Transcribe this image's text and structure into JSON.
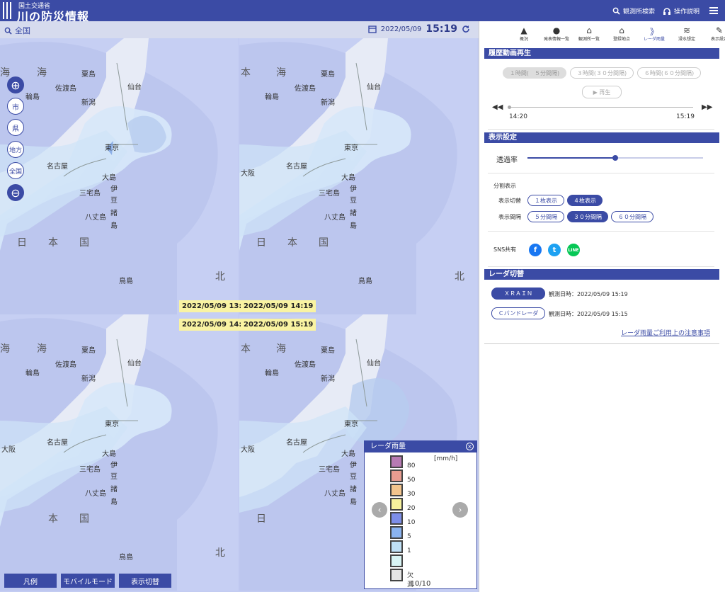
{
  "header": {
    "ministry": "国土交通省",
    "title": "川の防災情報",
    "station_search": "観測所検索",
    "help": "操作説明"
  },
  "map": {
    "area": "全国",
    "date": "2022/05/09",
    "time": "15:19",
    "panels": [
      {
        "timestamp": "2022/05/09 13:49"
      },
      {
        "timestamp": "2022/05/09 14:19"
      },
      {
        "timestamp": "2022/05/09 14:49"
      },
      {
        "timestamp": "2022/05/09 15:19"
      }
    ],
    "place_labels": {
      "sea1": "海",
      "sea2": "本",
      "sea3": "日",
      "sea4": "本",
      "sea5": "国",
      "sendai": "仙台",
      "niigata": "新潟",
      "sado": "佐渡島",
      "awa": "粟島",
      "wajima": "輪島",
      "tokyo": "東京",
      "nagoya": "名古屋",
      "osaka": "大阪",
      "oshima": "大島",
      "miyake": "三宅島",
      "izu1": "伊",
      "izu2": "豆",
      "izu3": "諸",
      "izu4": "島",
      "hachijo": "八丈島",
      "tori": "鳥島",
      "north": "北",
      "okushiri": "奥尻"
    },
    "zoom_controls": {
      "city": "市",
      "prefecture": "県",
      "region": "地方",
      "nationwide": "全国"
    },
    "buttons": {
      "legend": "凡例",
      "mobile": "モバイルモード",
      "display_switch": "表示切替"
    }
  },
  "legend": {
    "title": "レーダ雨量",
    "unit": "[mm/h]",
    "items": [
      {
        "label": "80",
        "color": "#b77ab3"
      },
      {
        "label": "50",
        "color": "#e89c90"
      },
      {
        "label": "30",
        "color": "#f2c48d"
      },
      {
        "label": "20",
        "color": "#f7f29c"
      },
      {
        "label": "10",
        "color": "#7d8ee8"
      },
      {
        "label": "5",
        "color": "#8ab3f0"
      },
      {
        "label": "1",
        "color": "#bfe0f6"
      },
      {
        "label": "",
        "color": "#d8f4f4"
      },
      {
        "label": "欠測",
        "color": "#e5e5e5"
      }
    ],
    "page": "10/10"
  },
  "side": {
    "tabs": [
      {
        "label": "概況",
        "icon": "warning-icon"
      },
      {
        "label": "発表情報一覧",
        "icon": "alert-icon"
      },
      {
        "label": "観測所一覧",
        "icon": "station-icon"
      },
      {
        "label": "登録地点",
        "icon": "home-icon"
      },
      {
        "label": "レーダ雨量",
        "icon": "radar-icon"
      },
      {
        "label": "浸水想定",
        "icon": "water-icon"
      },
      {
        "label": "表示設定",
        "icon": "wrench-icon"
      }
    ],
    "history": {
      "title": "履歴動画再生",
      "range_buttons": [
        "１時間(　５分間隔)",
        "３時間(３０分間隔)",
        "６時間(６０分間隔)"
      ],
      "play": "再生",
      "start_time": "14:20",
      "end_time": "15:19"
    },
    "display": {
      "title": "表示設定",
      "opacity_label": "透過率",
      "opacity_value": 0.5,
      "split_label": "分割表示",
      "switch_label": "表示切替",
      "switch_options": [
        "１枚表示",
        "４枚表示"
      ],
      "interval_label": "表示間隔",
      "interval_options": [
        "５分間隔",
        "３０分間隔",
        "６０分間隔"
      ],
      "sns_label": "SNS共有"
    },
    "radar": {
      "title": "レーダ切替",
      "xrain": "ＸＲＡＩＮ",
      "xrain_time": "観測日時：2022/05/09 15:19",
      "cband": "Ｃバンドレーダ",
      "cband_time": "観測日時：2022/05/09 15:15",
      "notice": "レーダ雨量ご利用上の注意事項"
    }
  }
}
